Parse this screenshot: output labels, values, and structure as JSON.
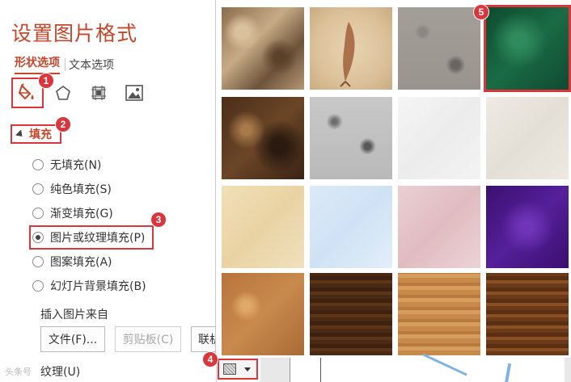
{
  "pane": {
    "title": "设置图片格式",
    "tabs": [
      "形状选项",
      "文本选项"
    ],
    "section_label": "填充",
    "radio_options": [
      {
        "label": "无填充(N)",
        "selected": false
      },
      {
        "label": "纯色填充(S)",
        "selected": false
      },
      {
        "label": "渐变填充(G)",
        "selected": false
      },
      {
        "label": "图片或纹理填充(P)",
        "selected": true
      },
      {
        "label": "图案填充(A)",
        "selected": false
      },
      {
        "label": "幻灯片背景填充(B)",
        "selected": false
      }
    ],
    "insert_from_label": "插入图片来自",
    "buttons": {
      "file": "文件(F)...",
      "clipboard": "剪贴板(C)",
      "online": "联机"
    },
    "texture_label": "纹理(U)",
    "watermark": "头条号"
  },
  "badges": [
    "1",
    "2",
    "3",
    "4",
    "5"
  ],
  "gallery": {
    "textures": [
      "纸袋",
      "鱼类化石",
      "砂砾",
      "绿色大理石",
      "褐色大理石",
      "花岗岩",
      "白色大理石",
      "再生纸",
      "羊皮纸",
      "蓝色面巾纸",
      "粉色面巾纸",
      "紫色网格",
      "软木塞",
      "胡桃",
      "栎木",
      "深色木质"
    ],
    "selected_index": 3
  },
  "colors": {
    "accent": "#c5462a",
    "highlight": "#d9363e"
  }
}
